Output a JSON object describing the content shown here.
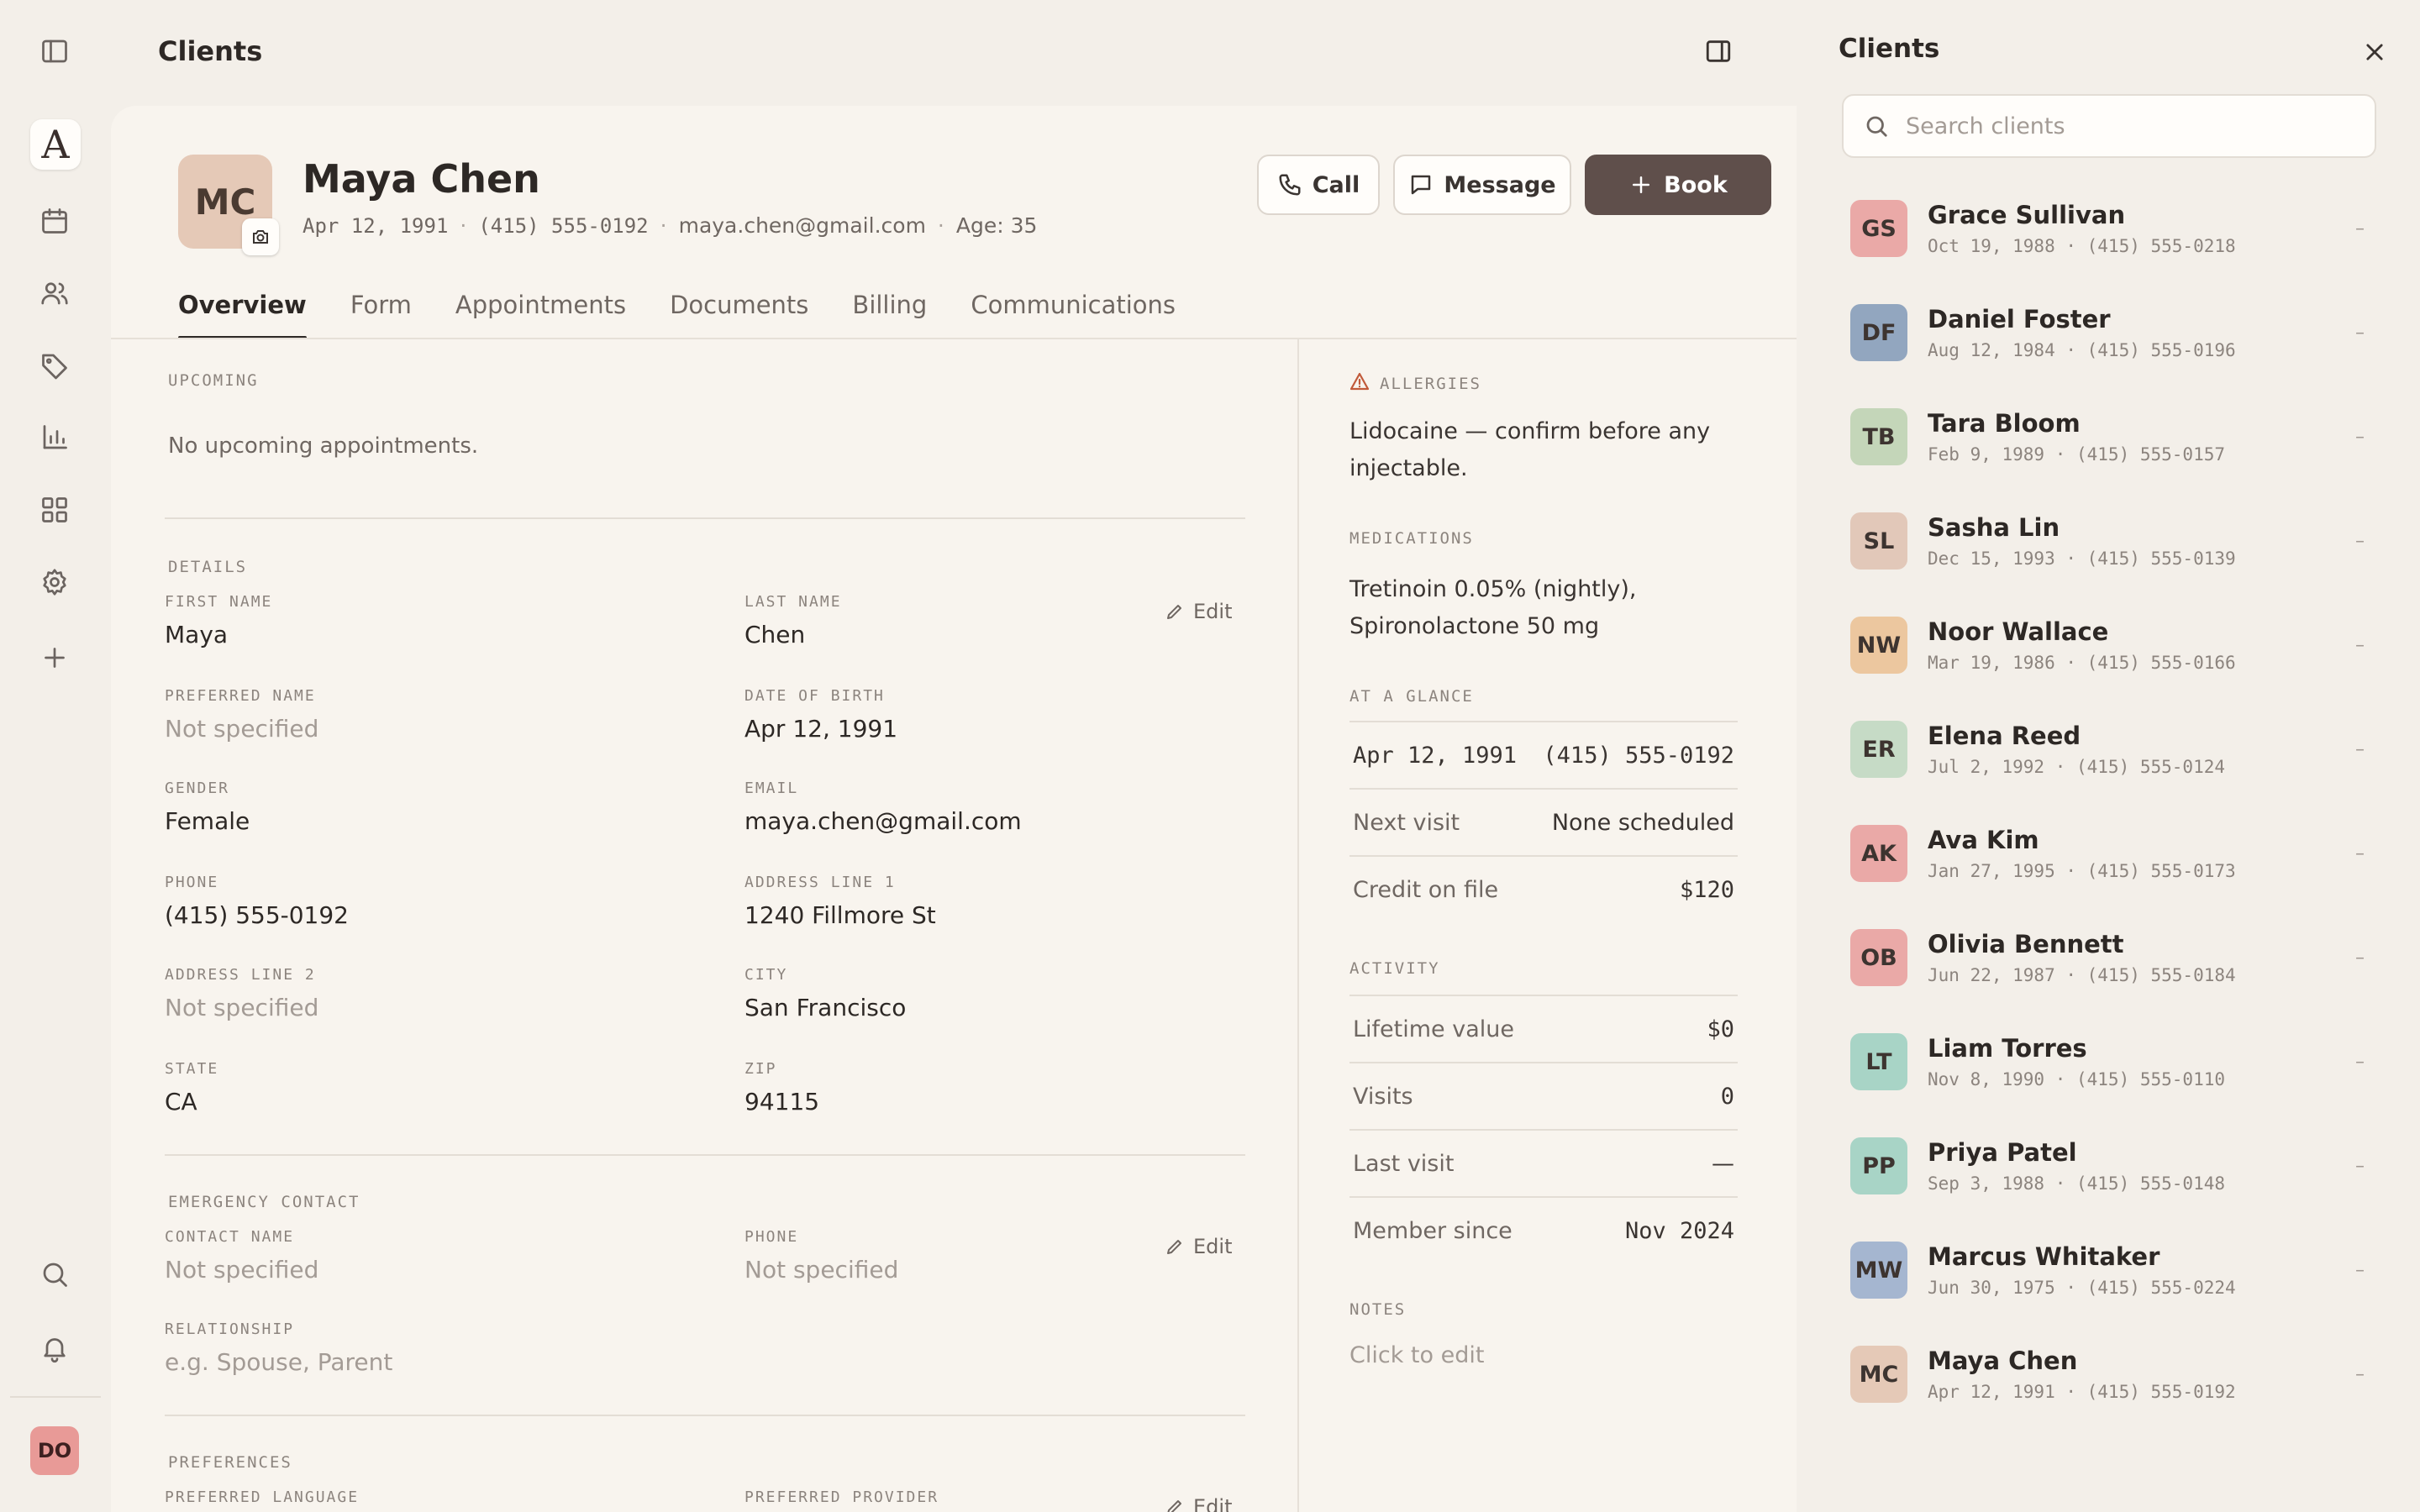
{
  "app": {
    "page_title": "Clients",
    "logo_letter": "A",
    "user_initials": "DO"
  },
  "rail": {
    "icons": [
      "sidebar-toggle-icon",
      "calendar-icon",
      "users-icon",
      "tag-icon",
      "bar-chart-icon",
      "grid-icon",
      "gear-icon",
      "plus-icon",
      "search-icon",
      "bell-icon"
    ]
  },
  "client": {
    "initials": "MC",
    "name": "Maya Chen",
    "dob": "Apr 12, 1991",
    "phone": "(415) 555-0192",
    "email": "maya.chen@gmail.com",
    "age": "Age: 35",
    "separator": "·"
  },
  "actions": {
    "call": "Call",
    "message": "Message",
    "book": "Book"
  },
  "tabs": [
    "Overview",
    "Form",
    "Appointments",
    "Documents",
    "Billing",
    "Communications"
  ],
  "upcoming": {
    "label": "UPCOMING",
    "empty": "No upcoming appointments."
  },
  "details": {
    "label": "DETAILS",
    "edit": "Edit",
    "fields": {
      "first_name": {
        "label": "FIRST NAME",
        "value": "Maya"
      },
      "last_name": {
        "label": "LAST NAME",
        "value": "Chen"
      },
      "preferred_name": {
        "label": "PREFERRED NAME",
        "value": "Not specified"
      },
      "dob": {
        "label": "DATE OF BIRTH",
        "value": "Apr 12, 1991"
      },
      "gender": {
        "label": "GENDER",
        "value": "Female"
      },
      "email": {
        "label": "EMAIL",
        "value": "maya.chen@gmail.com"
      },
      "phone": {
        "label": "PHONE",
        "value": "(415) 555-0192"
      },
      "address1": {
        "label": "ADDRESS LINE 1",
        "value": "1240 Fillmore St"
      },
      "address2": {
        "label": "ADDRESS LINE 2",
        "value": "Not specified"
      },
      "city": {
        "label": "CITY",
        "value": "San Francisco"
      },
      "state": {
        "label": "STATE",
        "value": "CA"
      },
      "zip": {
        "label": "ZIP",
        "value": "94115"
      }
    }
  },
  "emergency": {
    "label": "EMERGENCY CONTACT",
    "edit": "Edit",
    "contact_name": {
      "label": "CONTACT NAME",
      "value": "Not specified"
    },
    "phone": {
      "label": "PHONE",
      "value": "Not specified"
    },
    "relationship": {
      "label": "RELATIONSHIP",
      "value": "e.g. Spouse, Parent"
    }
  },
  "preferences": {
    "label": "PREFERENCES",
    "edit": "Edit",
    "language_label": "PREFERRED LANGUAGE",
    "provider_label": "PREFERRED PROVIDER"
  },
  "sidebar": {
    "allergies_label": "ALLERGIES",
    "allergies": "Lidocaine — confirm before any injectable.",
    "medications_label": "MEDICATIONS",
    "medications": "Tretinoin 0.05% (nightly), Spironolactone 50 mg",
    "glance_label": "AT A GLANCE",
    "glance_dob": "Apr 12, 1991",
    "glance_phone": "(415) 555-0192",
    "next_visit_label": "Next visit",
    "next_visit": "None scheduled",
    "credit_label": "Credit on file",
    "credit": "$120",
    "activity_label": "ACTIVITY",
    "lifetime_label": "Lifetime value",
    "lifetime": "$0",
    "visits_label": "Visits",
    "visits": "0",
    "last_visit_label": "Last visit",
    "last_visit": "—",
    "member_since_label": "Member since",
    "member_since": "Nov 2024",
    "notes_label": "NOTES",
    "notes_placeholder": "Click to edit"
  },
  "client_panel": {
    "title": "Clients",
    "search_placeholder": "Search clients",
    "clients": [
      {
        "initials": "GS",
        "name": "Grace Sullivan",
        "sub": "Oct 19, 1988 · (415) 555-0218",
        "color": "#eaa9a7",
        "trail": "–"
      },
      {
        "initials": "DF",
        "name": "Daniel Foster",
        "sub": "Aug 12, 1984 · (415) 555-0196",
        "color": "#92a6bf",
        "trail": "–"
      },
      {
        "initials": "TB",
        "name": "Tara Bloom",
        "sub": "Feb 9, 1989 · (415) 555-0157",
        "color": "#c4d6b9",
        "trail": "–"
      },
      {
        "initials": "SL",
        "name": "Sasha Lin",
        "sub": "Dec 15, 1993 · (415) 555-0139",
        "color": "#e2c8b9",
        "trail": "–"
      },
      {
        "initials": "NW",
        "name": "Noor Wallace",
        "sub": "Mar 19, 1986 · (415) 555-0166",
        "color": "#ecc79f",
        "trail": "–"
      },
      {
        "initials": "ER",
        "name": "Elena Reed",
        "sub": "Jul 2, 1992 · (415) 555-0124",
        "color": "#c6dbc6",
        "trail": "–"
      },
      {
        "initials": "AK",
        "name": "Ava Kim",
        "sub": "Jan 27, 1995 · (415) 555-0173",
        "color": "#eaa9a7",
        "trail": "–"
      },
      {
        "initials": "OB",
        "name": "Olivia Bennett",
        "sub": "Jun 22, 1987 · (415) 555-0184",
        "color": "#eaa9a7",
        "trail": "–"
      },
      {
        "initials": "LT",
        "name": "Liam Torres",
        "sub": "Nov 8, 1990 · (415) 555-0110",
        "color": "#a8d4c6",
        "trail": "–"
      },
      {
        "initials": "PP",
        "name": "Priya Patel",
        "sub": "Sep 3, 1988 · (415) 555-0148",
        "color": "#a8d4c6",
        "trail": "–"
      },
      {
        "initials": "MW",
        "name": "Marcus Whitaker",
        "sub": "Jun 30, 1975 · (415) 555-0224",
        "color": "#a5b6d0",
        "trail": "–"
      },
      {
        "initials": "MC",
        "name": "Maya Chen",
        "sub": "Apr 12, 1991 · (415) 555-0192",
        "color": "#e5c9b7",
        "trail": "–"
      }
    ]
  },
  "colors": {
    "accent": "#5f4f4b",
    "background": "#f3efe9",
    "card": "#f8f4ee",
    "warning": "#c15a3a"
  }
}
